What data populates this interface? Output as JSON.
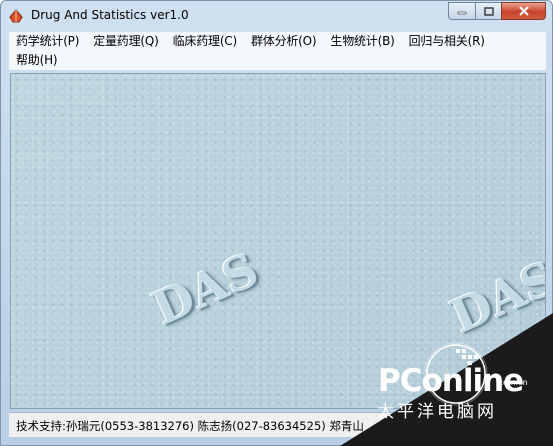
{
  "window": {
    "title": "Drug And Statistics ver1.0"
  },
  "menu": {
    "row1": [
      "药学统计(P)",
      "定量药理(Q)",
      "临床药理(C)",
      "群体分析(O)",
      "生物统计(B)",
      "回归与相关(R)"
    ],
    "row2": [
      "帮助(H)"
    ]
  },
  "background": {
    "watermark_text": "DAS"
  },
  "status": {
    "text": "技术支持:孙瑞元(0553-3813276) 陈志扬(027-83634525) 郑青山"
  },
  "overlay_watermark": {
    "logo": "PConline",
    "domain": ".com.cn",
    "chinese": "太平洋电脑网"
  },
  "colors": {
    "title_gradient": "#c6dbee",
    "close_button": "#c8442c",
    "client_bg": "#b7d0dc"
  }
}
